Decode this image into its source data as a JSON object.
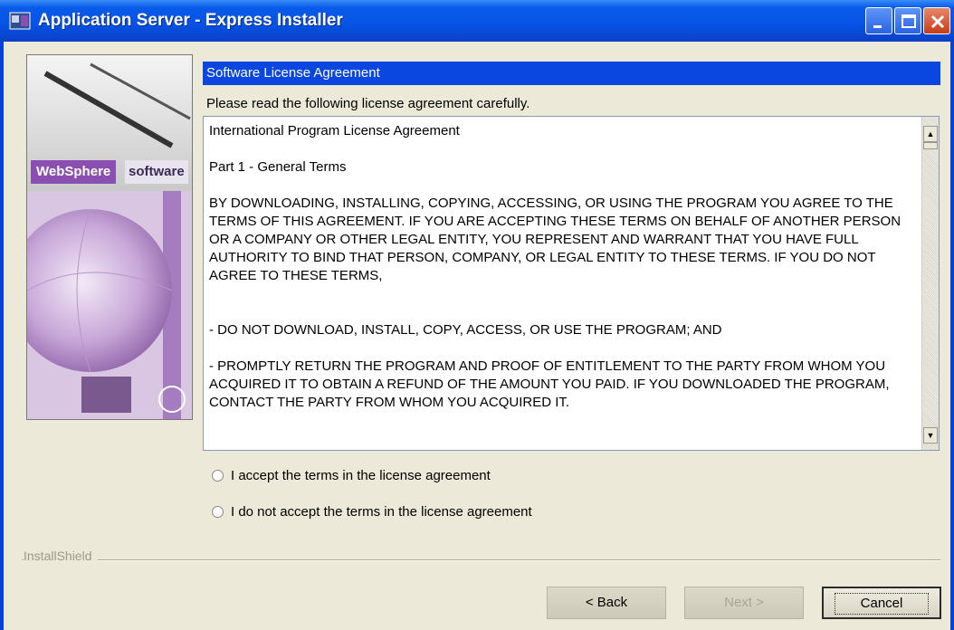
{
  "window": {
    "title": "Application Server - Express Installer"
  },
  "sidebar": {
    "brand": "WebSphere",
    "brand_suffix": "software"
  },
  "main": {
    "section_title": "Software License Agreement",
    "instruction": "Please read the following license agreement carefully.",
    "license_text": "International Program License Agreement\n\nPart 1 - General Terms\n\nBY DOWNLOADING, INSTALLING, COPYING, ACCESSING, OR USING THE PROGRAM YOU AGREE TO THE TERMS OF THIS AGREEMENT. IF YOU ARE ACCEPTING THESE TERMS ON BEHALF OF ANOTHER PERSON OR A COMPANY OR OTHER LEGAL ENTITY, YOU REPRESENT AND WARRANT THAT YOU HAVE FULL AUTHORITY TO BIND THAT PERSON, COMPANY, OR LEGAL ENTITY TO THESE TERMS. IF YOU DO NOT AGREE TO THESE TERMS,\n\n\n- DO NOT DOWNLOAD, INSTALL, COPY, ACCESS, OR USE THE PROGRAM; AND\n\n- PROMPTLY RETURN THE PROGRAM AND PROOF OF ENTITLEMENT TO THE PARTY FROM WHOM YOU ACQUIRED IT TO OBTAIN A REFUND OF THE AMOUNT YOU PAID. IF YOU DOWNLOADED THE PROGRAM, CONTACT THE PARTY FROM WHOM YOU ACQUIRED IT.",
    "options": [
      {
        "label": "I accept the terms in the license agreement",
        "selected": false
      },
      {
        "label": "I do not accept the terms in the license agreement",
        "selected": false
      }
    ]
  },
  "footer": {
    "installshield_label": "InstallShield",
    "back_label": "< Back",
    "next_label": "Next >",
    "cancel_label": "Cancel"
  },
  "colors": {
    "titlebar": "#0654e6",
    "section_header": "#0a46e0",
    "brand": "#8a4fb0",
    "dialog_bg": "#ece9d8"
  }
}
